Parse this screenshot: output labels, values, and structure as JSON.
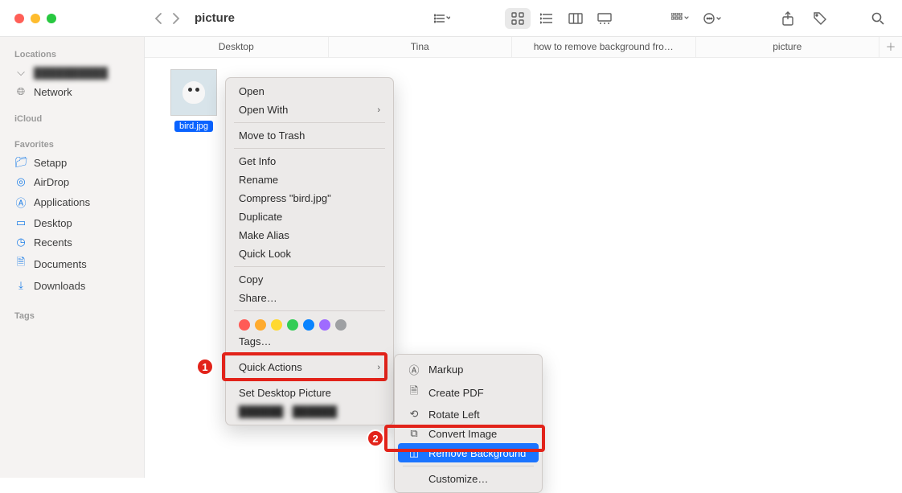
{
  "traffic_colors": {
    "close": "#ff5f57",
    "min": "#febc2e",
    "max": "#28c840"
  },
  "window_title": "picture",
  "path_tabs": [
    "Desktop",
    "Tina",
    "how to remove background fro…",
    "picture"
  ],
  "sidebar": {
    "locations_heading": "Locations",
    "locations": [
      {
        "icon": "disk",
        "label": "██████████"
      },
      {
        "icon": "globe",
        "label": "Network"
      }
    ],
    "icloud_heading": "iCloud",
    "favorites_heading": "Favorites",
    "favorites": [
      {
        "icon": "folder",
        "label": "Setapp"
      },
      {
        "icon": "airdrop",
        "label": "AirDrop"
      },
      {
        "icon": "apps",
        "label": "Applications"
      },
      {
        "icon": "desktop",
        "label": "Desktop"
      },
      {
        "icon": "clock",
        "label": "Recents"
      },
      {
        "icon": "doc",
        "label": "Documents"
      },
      {
        "icon": "download",
        "label": "Downloads"
      }
    ],
    "tags_heading": "Tags"
  },
  "file": {
    "name": "bird.jpg"
  },
  "context_menu": {
    "open": "Open",
    "open_with": "Open With",
    "move_to_trash": "Move to Trash",
    "get_info": "Get Info",
    "rename": "Rename",
    "compress": "Compress \"bird.jpg\"",
    "duplicate": "Duplicate",
    "make_alias": "Make Alias",
    "quick_look": "Quick Look",
    "copy": "Copy",
    "share": "Share…",
    "tag_colors": [
      "#ff5b56",
      "#ffab2e",
      "#ffd92f",
      "#32cd55",
      "#0a84ff",
      "#9f6bff",
      "#9ea0a3"
    ],
    "tags_label": "Tags…",
    "quick_actions": "Quick Actions",
    "set_desktop": "Set Desktop Picture",
    "blurred_item": "██████ · ██████"
  },
  "submenu": {
    "markup": "Markup",
    "create_pdf": "Create PDF",
    "rotate_left": "Rotate Left",
    "convert_image": "Convert Image",
    "remove_background": "Remove Background",
    "customize": "Customize…"
  },
  "callouts": {
    "one": "1",
    "two": "2"
  }
}
